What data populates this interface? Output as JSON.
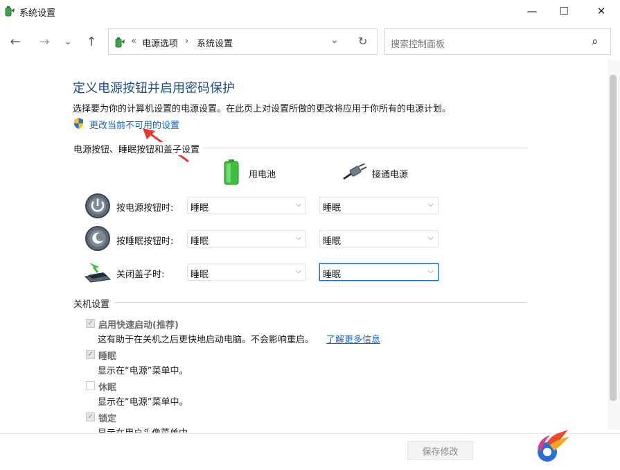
{
  "window": {
    "title": "系统设置",
    "minimize": "—",
    "maximize": "☐",
    "close": "✕"
  },
  "nav": {
    "back": "←",
    "forward": "→",
    "recent": "⌄",
    "up": "↑",
    "breadcrumb_sep0": "«",
    "breadcrumb": [
      "电源选项",
      "系统设置"
    ],
    "breadcrumb_sep1": "›",
    "dropdown": "⌄",
    "refresh": "↻",
    "search_placeholder": "搜索控制面板",
    "search_icon": "⌕"
  },
  "main": {
    "heading": "定义电源按钮并启用密码保护",
    "description": "选择要为你的计算机设置的电源设置。在此页上对设置所做的更改将应用于你所有的电源计划。",
    "change_link": "更改当前不可用的设置",
    "section_buttons": "电源按钮、睡眠按钮和盖子设置",
    "col_battery": "用电池",
    "col_plugged": "接通电源",
    "rows": [
      {
        "label": "按电源按钮时:",
        "battery": "睡眠",
        "plugged": "睡眠"
      },
      {
        "label": "按睡眠按钮时:",
        "battery": "睡眠",
        "plugged": "睡眠"
      },
      {
        "label": "关闭盖子时:",
        "battery": "睡眠",
        "plugged": "睡眠"
      }
    ],
    "section_shutdown": "关机设置",
    "shutdown_items": [
      {
        "label": "启用快速启动(推荐)",
        "desc": "这有助于在关机之后更快地启动电脑。不会影响重启。",
        "link": "了解更多信息",
        "checked": true
      },
      {
        "label": "睡眠",
        "desc": "显示在“电源”菜单中。",
        "checked": true
      },
      {
        "label": "休眠",
        "desc": "显示在“电源”菜单中。",
        "checked": false
      },
      {
        "label": "锁定",
        "desc": "显示在用户头像菜单中。",
        "checked": true
      }
    ]
  },
  "footer": {
    "save_label": "保存修改"
  },
  "chevron": "⌵",
  "checkmark": "✓",
  "colors": {
    "heading": "#1f4e8c",
    "link": "#1565c0",
    "annotation_arrow": "#e53935"
  }
}
